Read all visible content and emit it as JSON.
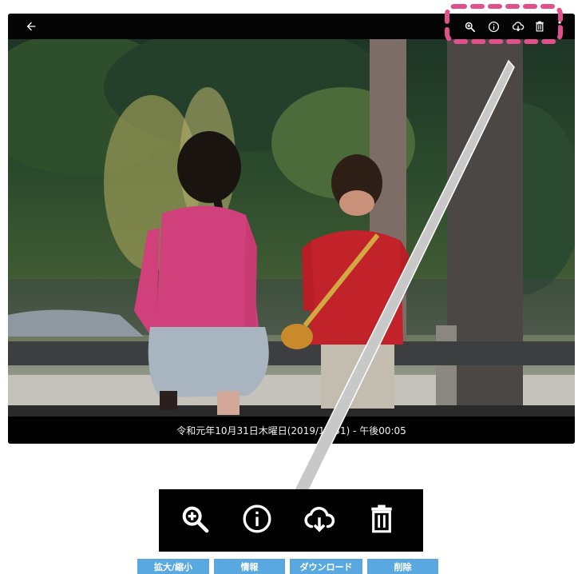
{
  "viewer": {
    "toolbar": {
      "back_icon": "arrow-left-icon",
      "actions": [
        {
          "name": "zoom-in-icon"
        },
        {
          "name": "info-icon"
        },
        {
          "name": "cloud-download-icon"
        },
        {
          "name": "trash-icon"
        },
        {
          "name": "more-vertical-icon"
        }
      ]
    },
    "photo": {
      "subject": "photo"
    },
    "caption": "令和元年10月31日木曜日(2019/10/31) - 午後00:05"
  },
  "callout": {
    "highlight_color": "#e0508a",
    "labels": [
      "拡大/縮小",
      "情報",
      "ダウンロード",
      "削除"
    ],
    "label_color": "#5aa8e0"
  }
}
